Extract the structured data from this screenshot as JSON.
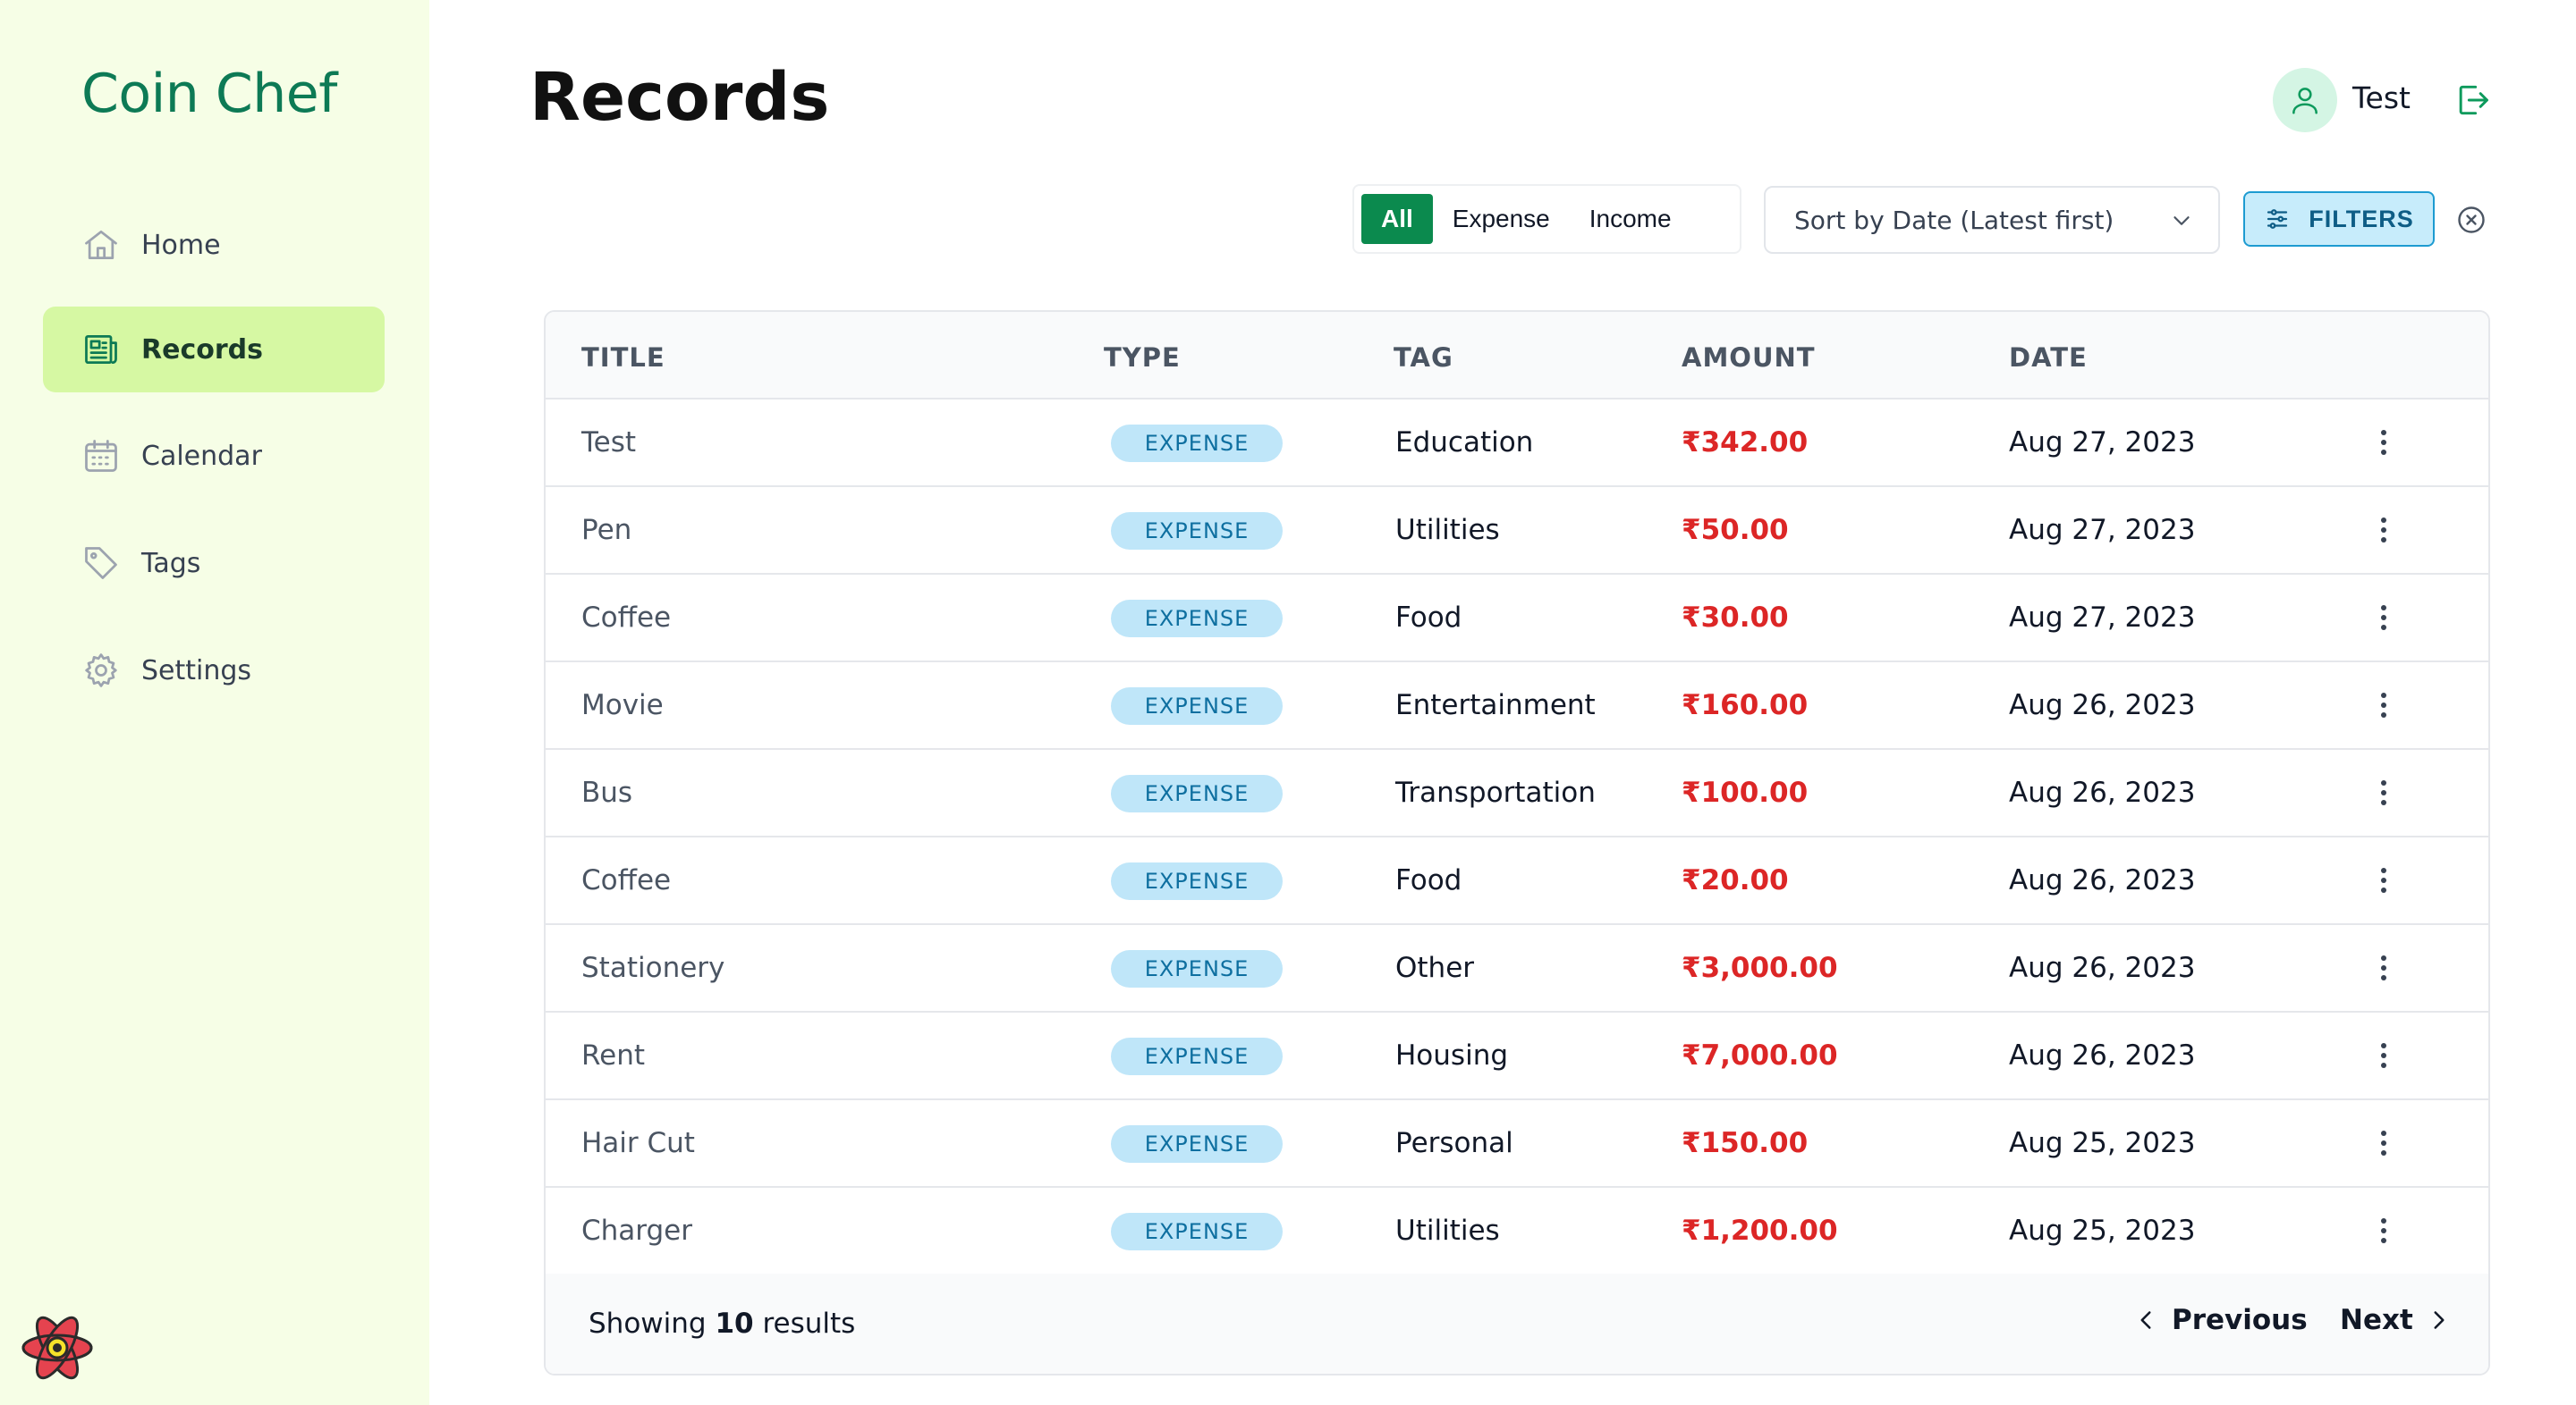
{
  "app": {
    "brand": "Coin Chef"
  },
  "sidebar": {
    "items": [
      {
        "label": "Home",
        "icon": "home-icon",
        "active": false
      },
      {
        "label": "Records",
        "icon": "newspaper-icon",
        "active": true
      },
      {
        "label": "Calendar",
        "icon": "calendar-icon",
        "active": false
      },
      {
        "label": "Tags",
        "icon": "tag-icon",
        "active": false
      },
      {
        "label": "Settings",
        "icon": "gear-icon",
        "active": false
      }
    ]
  },
  "header": {
    "title": "Records",
    "username": "Test"
  },
  "toolbar": {
    "type_options": [
      "All",
      "Expense",
      "Income"
    ],
    "selected_type": "All",
    "sort_value": "Sort by Date (Latest first)",
    "filters_label": "FILTERS"
  },
  "table": {
    "columns": [
      "TITLE",
      "TYPE",
      "TAG",
      "AMOUNT",
      "DATE"
    ],
    "rows": [
      {
        "title": "Test",
        "type": "EXPENSE",
        "tag": "Education",
        "amount": "₹342.00",
        "date": "Aug 27, 2023"
      },
      {
        "title": "Pen",
        "type": "EXPENSE",
        "tag": "Utilities",
        "amount": "₹50.00",
        "date": "Aug 27, 2023"
      },
      {
        "title": "Coffee",
        "type": "EXPENSE",
        "tag": "Food",
        "amount": "₹30.00",
        "date": "Aug 27, 2023"
      },
      {
        "title": "Movie",
        "type": "EXPENSE",
        "tag": "Entertainment",
        "amount": "₹160.00",
        "date": "Aug 26, 2023"
      },
      {
        "title": "Bus",
        "type": "EXPENSE",
        "tag": "Transportation",
        "amount": "₹100.00",
        "date": "Aug 26, 2023"
      },
      {
        "title": "Coffee",
        "type": "EXPENSE",
        "tag": "Food",
        "amount": "₹20.00",
        "date": "Aug 26, 2023"
      },
      {
        "title": "Stationery",
        "type": "EXPENSE",
        "tag": "Other",
        "amount": "₹3,000.00",
        "date": "Aug 26, 2023"
      },
      {
        "title": "Rent",
        "type": "EXPENSE",
        "tag": "Housing",
        "amount": "₹7,000.00",
        "date": "Aug 26, 2023"
      },
      {
        "title": "Hair Cut",
        "type": "EXPENSE",
        "tag": "Personal",
        "amount": "₹150.00",
        "date": "Aug 25, 2023"
      },
      {
        "title": "Charger",
        "type": "EXPENSE",
        "tag": "Utilities",
        "amount": "₹1,200.00",
        "date": "Aug 25, 2023"
      }
    ]
  },
  "footer": {
    "showing_prefix": "Showing",
    "count": "10",
    "showing_suffix": "results",
    "previous_label": "Previous",
    "next_label": "Next"
  },
  "colors": {
    "brand": "#0d7a55",
    "sidebar_bg": "#f6fee6",
    "active_nav": "#d6f8a3",
    "expense_amount": "#dc2626",
    "badge_bg": "#bfe6f9"
  }
}
